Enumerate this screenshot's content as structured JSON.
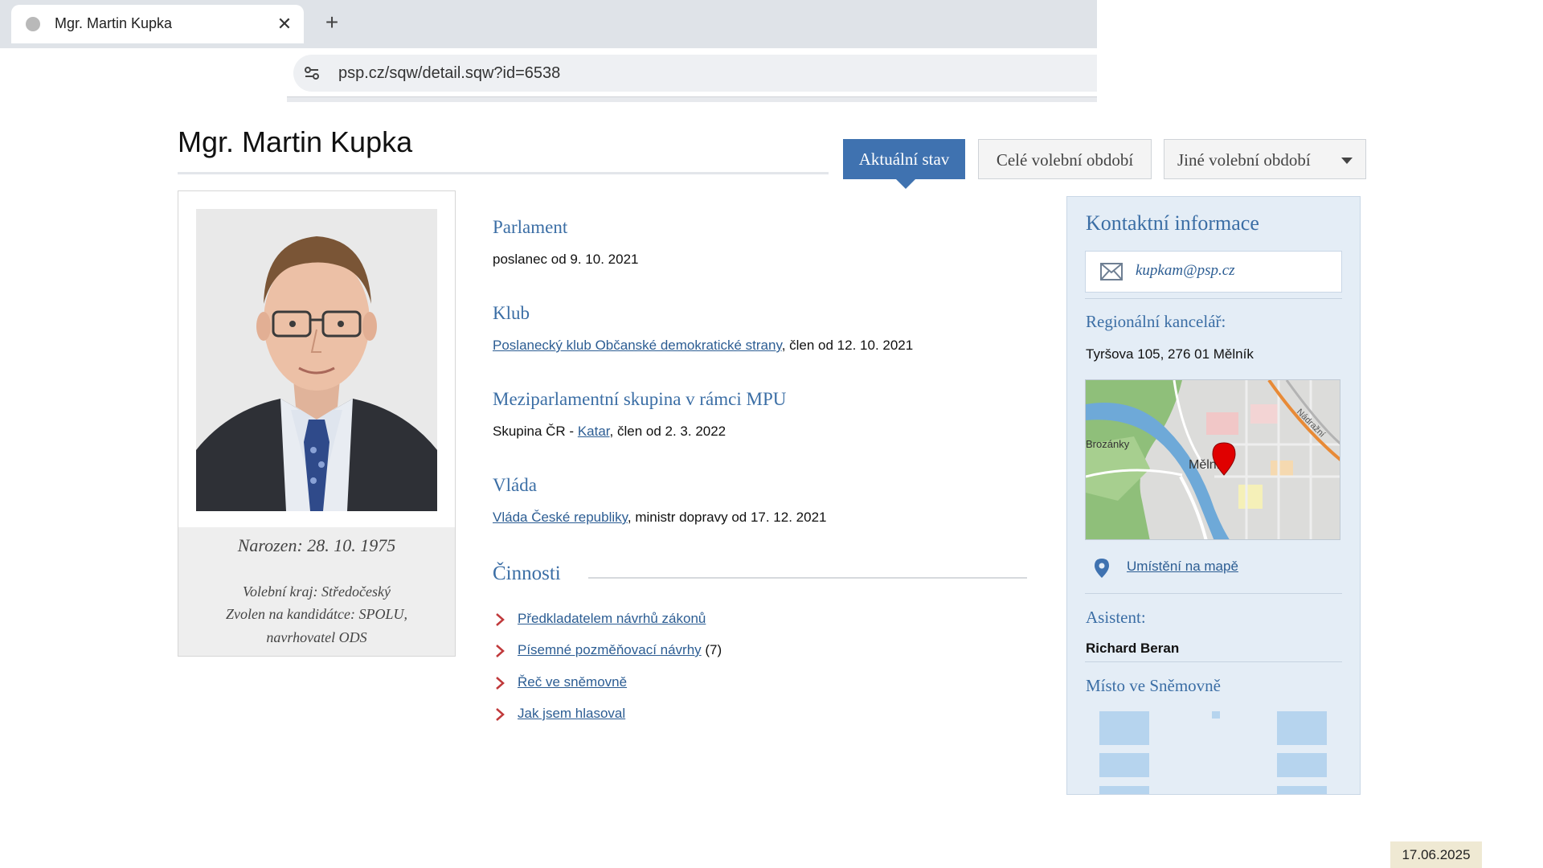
{
  "browser": {
    "tab_title": "Mgr. Martin Kupka",
    "url": "psp.cz/sqw/detail.sqw?id=6538",
    "close_glyph": "✕",
    "new_tab_glyph": "+"
  },
  "page": {
    "title": "Mgr. Martin Kupka"
  },
  "tabs": {
    "current": "Aktuální stav",
    "full_term": "Celé volební období",
    "other_term": "Jiné volební období"
  },
  "profile": {
    "born": "Narozen: 28. 10. 1975",
    "region": "Volební kraj: Středočeský",
    "elected": "Zvolen na kandidátce: SPOLU,",
    "nominator": "navrhovatel ODS"
  },
  "sections": {
    "parliament": {
      "title": "Parlament",
      "text": "poslanec od 9. 10. 2021"
    },
    "club": {
      "title": "Klub",
      "link": "Poslanecký klub Občanské demokratické strany",
      "text": ", člen od 12. 10. 2021"
    },
    "mpu": {
      "title": "Meziparlamentní skupina v rámci MPU",
      "prefix": "Skupina ČR - ",
      "link": "Katar",
      "text": ", člen od 2. 3. 2022"
    },
    "government": {
      "title": "Vláda",
      "link": "Vláda České republiky",
      "text": ", ministr dopravy od 17. 12. 2021"
    }
  },
  "activities": {
    "title": "Činnosti",
    "items": [
      {
        "label": "Předkladatelem návrhů zákonů",
        "count": ""
      },
      {
        "label": "Písemné pozměňovací návrhy",
        "count": " (7)"
      },
      {
        "label": "Řeč ve sněmovně",
        "count": ""
      },
      {
        "label": "Jak jsem hlasoval",
        "count": ""
      }
    ]
  },
  "contact": {
    "title": "Kontaktní informace",
    "email": "kupkam@psp.cz",
    "office_label": "Regionální kancelář:",
    "office_address": "Tyršova 105, 276 01  Mělník",
    "map_place_left": "Brozánky",
    "map_place_center": "Mělník",
    "map_road_label": "Nádražní",
    "map_link": "Umístění na mapě",
    "assistant_label": "Asistent:",
    "assistant_name": "Richard Beran",
    "seat_label": "Místo ve Sněmovně"
  },
  "footer": {
    "date": "17.06.2025"
  },
  "colors": {
    "accent_blue": "#3f72b0",
    "heading_blue": "#3b6ea5",
    "link_blue": "#2c5d93",
    "panel_bg": "#e4edf6",
    "chevron_red": "#c0393b"
  }
}
